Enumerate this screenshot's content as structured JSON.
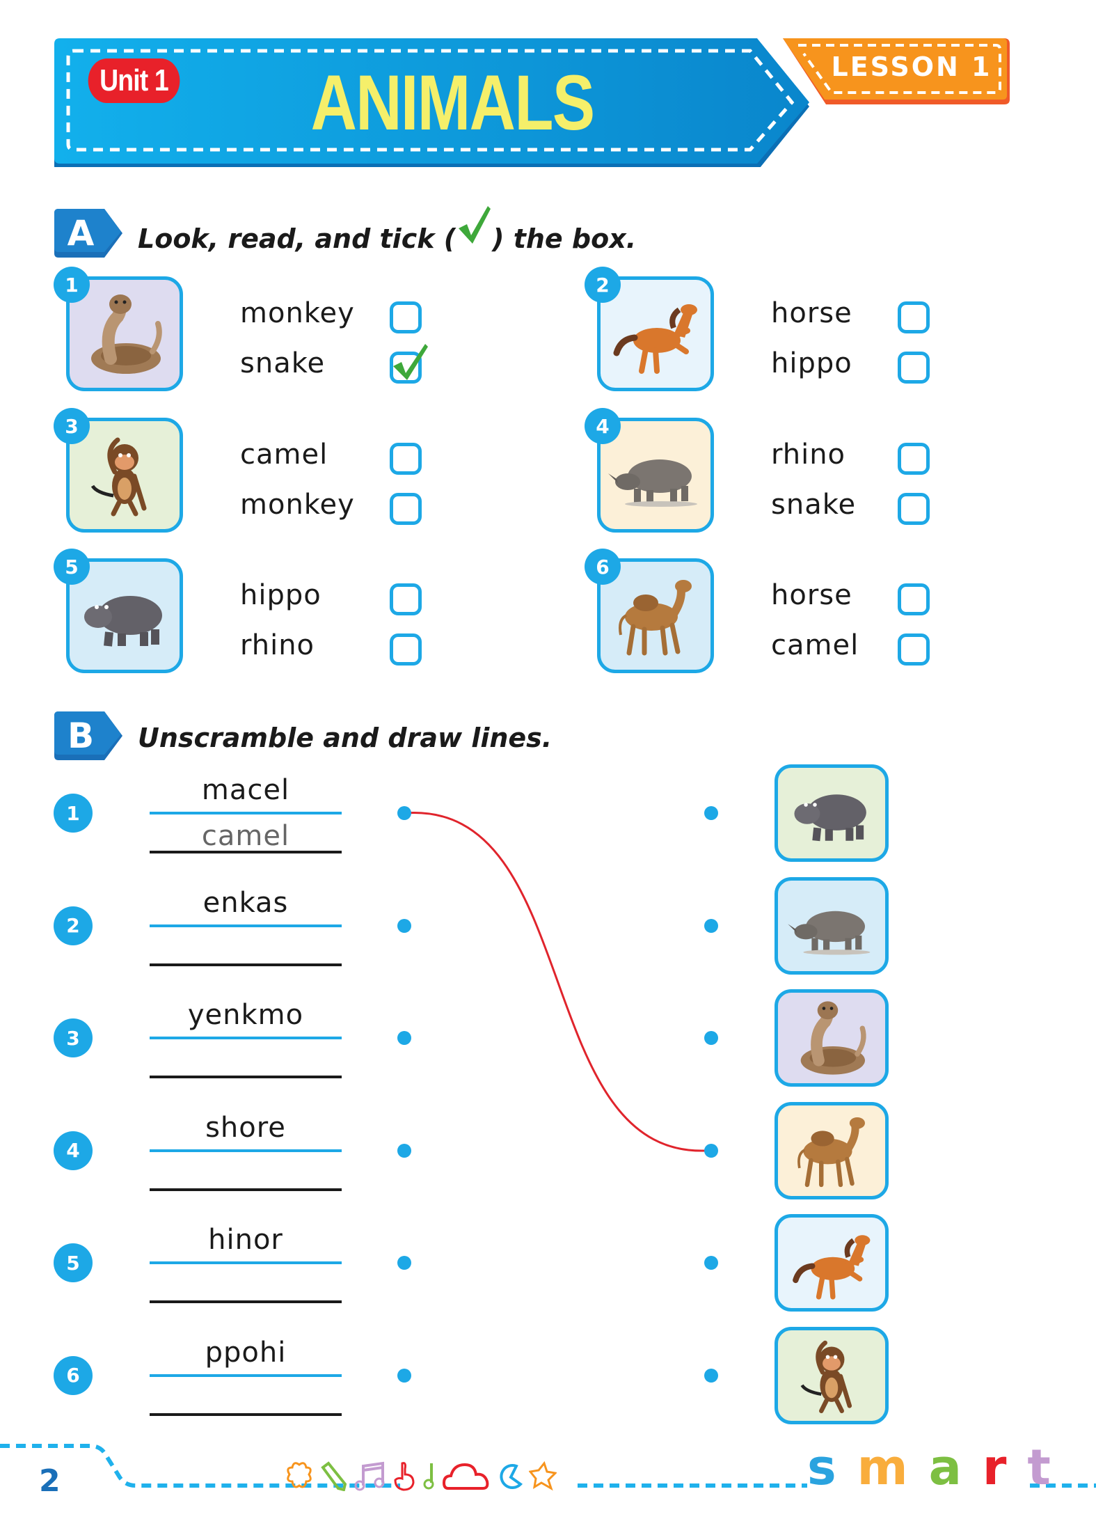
{
  "header": {
    "unit_label": "Unit 1",
    "title": "ANIMALS",
    "lesson_label": "LESSON 1"
  },
  "section_a": {
    "badge": "A",
    "instruction_before": "Look, read, and tick (",
    "instruction_after": ") the box.",
    "items": [
      {
        "number": "1",
        "animal_icon": "snake-icon",
        "bg": "#dedcf0",
        "options": [
          {
            "label": "monkey",
            "checked": false
          },
          {
            "label": "snake",
            "checked": true
          }
        ]
      },
      {
        "number": "2",
        "animal_icon": "horse-icon",
        "bg": "#e8f4fc",
        "options": [
          {
            "label": "horse",
            "checked": false
          },
          {
            "label": "hippo",
            "checked": false
          }
        ]
      },
      {
        "number": "3",
        "animal_icon": "monkey-icon",
        "bg": "#e6f0d8",
        "options": [
          {
            "label": "camel",
            "checked": false
          },
          {
            "label": "monkey",
            "checked": false
          }
        ]
      },
      {
        "number": "4",
        "animal_icon": "rhino-icon",
        "bg": "#fcf0d8",
        "options": [
          {
            "label": "rhino",
            "checked": false
          },
          {
            "label": "snake",
            "checked": false
          }
        ]
      },
      {
        "number": "5",
        "animal_icon": "hippo-icon",
        "bg": "#d6ecf8",
        "options": [
          {
            "label": "hippo",
            "checked": false
          },
          {
            "label": "rhino",
            "checked": false
          }
        ]
      },
      {
        "number": "6",
        "animal_icon": "camel-icon",
        "bg": "#d6ecf8",
        "options": [
          {
            "label": "horse",
            "checked": false
          },
          {
            "label": "camel",
            "checked": false
          }
        ]
      }
    ]
  },
  "section_b": {
    "badge": "B",
    "instruction": "Unscramble and draw lines.",
    "rows": [
      {
        "number": "1",
        "scrambled": "macel",
        "answer": "camel"
      },
      {
        "number": "2",
        "scrambled": "enkas",
        "answer": ""
      },
      {
        "number": "3",
        "scrambled": "yenkmo",
        "answer": ""
      },
      {
        "number": "4",
        "scrambled": "shore",
        "answer": ""
      },
      {
        "number": "5",
        "scrambled": "hinor",
        "answer": ""
      },
      {
        "number": "6",
        "scrambled": "ppohi",
        "answer": ""
      }
    ],
    "pictures": [
      {
        "animal_icon": "hippo-icon",
        "bg": "#e6f0d8"
      },
      {
        "animal_icon": "rhino-icon",
        "bg": "#d6ecf8"
      },
      {
        "animal_icon": "snake-icon",
        "bg": "#dedcf0"
      },
      {
        "animal_icon": "camel-icon",
        "bg": "#fcf0d8"
      },
      {
        "animal_icon": "horse-icon",
        "bg": "#e8f4fc"
      },
      {
        "animal_icon": "monkey-icon",
        "bg": "#e6f0d8"
      }
    ],
    "drawn_lines": [
      {
        "from_row": 1,
        "to_picture": 4,
        "color": "#e0242c"
      }
    ]
  },
  "footer": {
    "page_number": "2",
    "brand_letters": [
      {
        "char": "s",
        "color": "#2aa3df"
      },
      {
        "char": "m",
        "color": "#f9ad3c"
      },
      {
        "char": "a",
        "color": "#7dbf42"
      },
      {
        "char": "r",
        "color": "#e8212a"
      },
      {
        "char": "t",
        "color": "#c39bd0"
      }
    ],
    "decor_icons": [
      {
        "name": "flower-icon",
        "color": "#f7941d"
      },
      {
        "name": "pencil-icon",
        "color": "#7dbf42"
      },
      {
        "name": "music-notes-icon",
        "color": "#c39bd0"
      },
      {
        "name": "pointing-hand-icon",
        "color": "#e8212a"
      },
      {
        "name": "music-note-icon",
        "color": "#7dbf42"
      },
      {
        "name": "cloud-icon",
        "color": "#e8212a"
      },
      {
        "name": "pacman-icon",
        "color": "#1da8e6"
      },
      {
        "name": "star-icon",
        "color": "#f7941d"
      }
    ]
  },
  "colors": {
    "primary_blue": "#1da8e6",
    "header_blue": "#0b94dc",
    "title_yellow": "#f5ef6a",
    "unit_red": "#e8212a",
    "lesson_orange": "#f7941d",
    "tick_green": "#3ea83a",
    "match_line_red": "#e0242c"
  }
}
